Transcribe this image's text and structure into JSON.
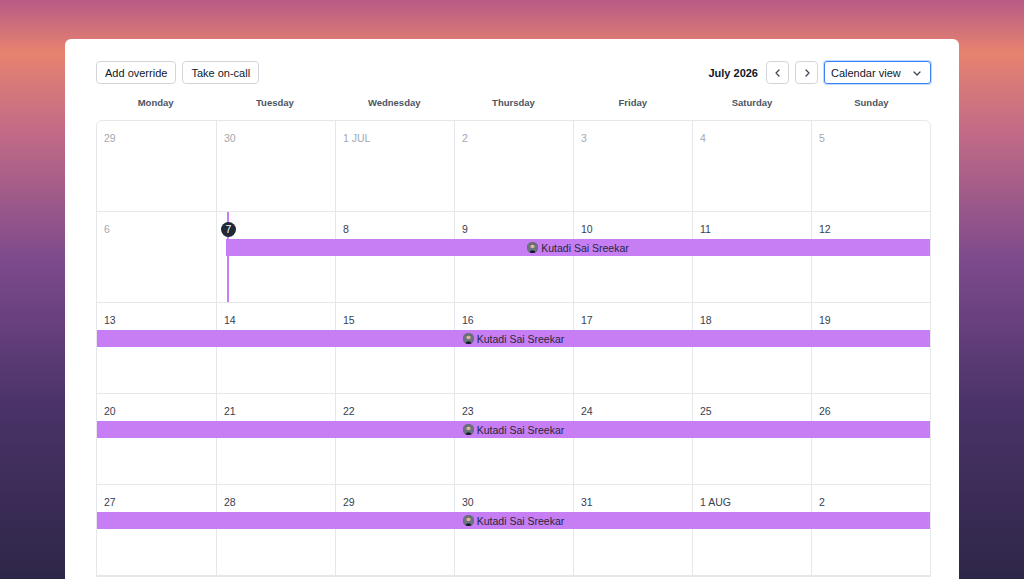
{
  "toolbar": {
    "buttons": [
      "Add override",
      "Take on-call"
    ],
    "month": "July 2026",
    "view_select": {
      "value": "Calendar view",
      "focused": true
    }
  },
  "weekdays": [
    "Monday",
    "Tuesday",
    "Wednesday",
    "Thursday",
    "Friday",
    "Saturday",
    "Sunday"
  ],
  "weeks": [
    {
      "days": [
        {
          "label": "29",
          "muted": true,
          "today": false
        },
        {
          "label": "30",
          "muted": true,
          "today": false
        },
        {
          "label": "1 JUL",
          "muted": true,
          "today": false
        },
        {
          "label": "2",
          "muted": true,
          "today": false
        },
        {
          "label": "3",
          "muted": true,
          "today": false
        },
        {
          "label": "4",
          "muted": true,
          "today": false
        },
        {
          "label": "5",
          "muted": true,
          "today": false
        }
      ],
      "events": []
    },
    {
      "days": [
        {
          "label": "6",
          "muted": true,
          "today": false
        },
        {
          "label": "7",
          "muted": false,
          "today": true
        },
        {
          "label": "8",
          "muted": false,
          "today": false
        },
        {
          "label": "9",
          "muted": false,
          "today": false
        },
        {
          "label": "10",
          "muted": false,
          "today": false
        },
        {
          "label": "11",
          "muted": false,
          "today": false
        },
        {
          "label": "12",
          "muted": false,
          "today": false
        }
      ],
      "events": [
        {
          "name": "Kutadi Sai Sreekar",
          "span": [
            1,
            6
          ],
          "color": "#c77df3"
        }
      ]
    },
    {
      "days": [
        {
          "label": "13",
          "muted": false,
          "today": false
        },
        {
          "label": "14",
          "muted": false,
          "today": false
        },
        {
          "label": "15",
          "muted": false,
          "today": false
        },
        {
          "label": "16",
          "muted": false,
          "today": false
        },
        {
          "label": "17",
          "muted": false,
          "today": false
        },
        {
          "label": "18",
          "muted": false,
          "today": false
        },
        {
          "label": "19",
          "muted": false,
          "today": false
        }
      ],
      "events": [
        {
          "name": "Kutadi Sai Sreekar",
          "span": [
            0,
            6
          ],
          "color": "#c77df3"
        }
      ]
    },
    {
      "days": [
        {
          "label": "20",
          "muted": false,
          "today": false
        },
        {
          "label": "21",
          "muted": false,
          "today": false
        },
        {
          "label": "22",
          "muted": false,
          "today": false
        },
        {
          "label": "23",
          "muted": false,
          "today": false
        },
        {
          "label": "24",
          "muted": false,
          "today": false
        },
        {
          "label": "25",
          "muted": false,
          "today": false
        },
        {
          "label": "26",
          "muted": false,
          "today": false
        }
      ],
      "events": [
        {
          "name": "Kutadi Sai Sreekar",
          "span": [
            0,
            6
          ],
          "color": "#c77df3"
        }
      ]
    },
    {
      "days": [
        {
          "label": "27",
          "muted": false,
          "today": false
        },
        {
          "label": "28",
          "muted": false,
          "today": false
        },
        {
          "label": "29",
          "muted": false,
          "today": false
        },
        {
          "label": "30",
          "muted": false,
          "today": false
        },
        {
          "label": "31",
          "muted": false,
          "today": false
        },
        {
          "label": "1 AUG",
          "muted": false,
          "today": false
        },
        {
          "label": "2",
          "muted": false,
          "today": false
        }
      ],
      "events": [
        {
          "name": "Kutadi Sai Sreekar",
          "span": [
            0,
            6
          ],
          "color": "#c77df3"
        }
      ]
    }
  ]
}
